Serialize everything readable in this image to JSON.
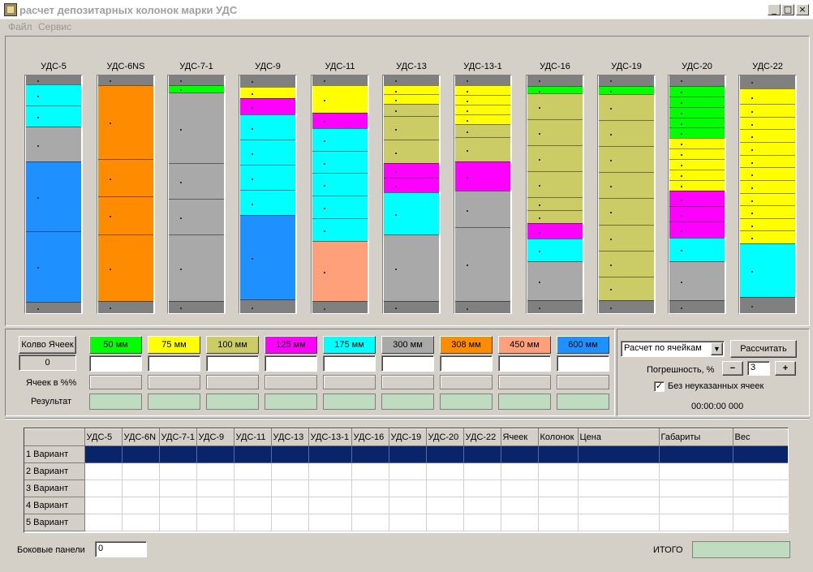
{
  "window": {
    "title": "расчет депозитарных колонок марки УДС",
    "minimize": "_",
    "maximize": "□",
    "close": "×"
  },
  "menu": {
    "file": "Файл",
    "service": "Сервис"
  },
  "columns": [
    {
      "label": "УДС-5",
      "segments": [
        {
          "color": "#808080",
          "frac": 0.04
        },
        {
          "color": "#00ffff",
          "frac": 0.09
        },
        {
          "color": "#00ffff",
          "frac": 0.09
        },
        {
          "color": "#a9a9a9",
          "frac": 0.15
        },
        {
          "color": "#1e90ff",
          "frac": 0.3
        },
        {
          "color": "#1e90ff",
          "frac": 0.3
        },
        {
          "color": "#808080",
          "frac": 0.05
        }
      ]
    },
    {
      "label": "УДС-6NS",
      "segments": [
        {
          "color": "#808080",
          "frac": 0.04
        },
        {
          "color": "#ff8c00",
          "frac": 0.31
        },
        {
          "color": "#ff8c00",
          "frac": 0.16
        },
        {
          "color": "#ff8c00",
          "frac": 0.16
        },
        {
          "color": "#ff8c00",
          "frac": 0.28
        },
        {
          "color": "#808080",
          "frac": 0.05
        }
      ]
    },
    {
      "label": "УДС-7-1",
      "segments": [
        {
          "color": "#808080",
          "frac": 0.04
        },
        {
          "color": "#00ff00",
          "frac": 0.03
        },
        {
          "color": "#a9a9a9",
          "frac": 0.3
        },
        {
          "color": "#a9a9a9",
          "frac": 0.15
        },
        {
          "color": "#a9a9a9",
          "frac": 0.15
        },
        {
          "color": "#a9a9a9",
          "frac": 0.28
        },
        {
          "color": "#808080",
          "frac": 0.05
        }
      ]
    },
    {
      "label": "УДС-9",
      "segments": [
        {
          "color": "#808080",
          "frac": 0.04
        },
        {
          "color": "#ffff00",
          "frac": 0.04
        },
        {
          "color": "#ff00ff",
          "frac": 0.06
        },
        {
          "color": "#00ffff",
          "frac": 0.09
        },
        {
          "color": "#00ffff",
          "frac": 0.09
        },
        {
          "color": "#00ffff",
          "frac": 0.09
        },
        {
          "color": "#00ffff",
          "frac": 0.09
        },
        {
          "color": "#1e90ff",
          "frac": 0.3
        },
        {
          "color": "#808080",
          "frac": 0.05
        }
      ]
    },
    {
      "label": "УДС-11",
      "segments": [
        {
          "color": "#808080",
          "frac": 0.04
        },
        {
          "color": "#ffff00",
          "frac": 0.11
        },
        {
          "color": "#ff00ff",
          "frac": 0.06
        },
        {
          "color": "#00ffff",
          "frac": 0.09
        },
        {
          "color": "#00ffff",
          "frac": 0.09
        },
        {
          "color": "#00ffff",
          "frac": 0.09
        },
        {
          "color": "#00ffff",
          "frac": 0.09
        },
        {
          "color": "#00ffff",
          "frac": 0.09
        },
        {
          "color": "#ffa07a",
          "frac": 0.24
        },
        {
          "color": "#808080",
          "frac": 0.05
        }
      ]
    },
    {
      "label": "УДС-13",
      "segments": [
        {
          "color": "#808080",
          "frac": 0.04
        },
        {
          "color": "#ffff00",
          "frac": 0.04
        },
        {
          "color": "#ffff00",
          "frac": 0.04
        },
        {
          "color": "#cccc66",
          "frac": 0.05
        },
        {
          "color": "#cccc66",
          "frac": 0.1
        },
        {
          "color": "#cccc66",
          "frac": 0.1
        },
        {
          "color": "#ff00ff",
          "frac": 0.06
        },
        {
          "color": "#ff00ff",
          "frac": 0.06
        },
        {
          "color": "#00ffff",
          "frac": 0.18
        },
        {
          "color": "#a9a9a9",
          "frac": 0.28
        },
        {
          "color": "#808080",
          "frac": 0.05
        }
      ]
    },
    {
      "label": "УДС-13-1",
      "segments": [
        {
          "color": "#808080",
          "frac": 0.04
        },
        {
          "color": "#ffff00",
          "frac": 0.04
        },
        {
          "color": "#ffff00",
          "frac": 0.04
        },
        {
          "color": "#ffff00",
          "frac": 0.04
        },
        {
          "color": "#ffff00",
          "frac": 0.04
        },
        {
          "color": "#cccc66",
          "frac": 0.05
        },
        {
          "color": "#cccc66",
          "frac": 0.1
        },
        {
          "color": "#ff00ff",
          "frac": 0.12
        },
        {
          "color": "#a9a9a9",
          "frac": 0.15
        },
        {
          "color": "#a9a9a9",
          "frac": 0.3
        },
        {
          "color": "#808080",
          "frac": 0.05
        }
      ]
    },
    {
      "label": "УДС-16",
      "segments": [
        {
          "color": "#808080",
          "frac": 0.04
        },
        {
          "color": "#00ff00",
          "frac": 0.03
        },
        {
          "color": "#cccc66",
          "frac": 0.1
        },
        {
          "color": "#cccc66",
          "frac": 0.1
        },
        {
          "color": "#cccc66",
          "frac": 0.1
        },
        {
          "color": "#cccc66",
          "frac": 0.1
        },
        {
          "color": "#cccc66",
          "frac": 0.05
        },
        {
          "color": "#cccc66",
          "frac": 0.05
        },
        {
          "color": "#ff00ff",
          "frac": 0.06
        },
        {
          "color": "#00ffff",
          "frac": 0.09
        },
        {
          "color": "#a9a9a9",
          "frac": 0.15
        },
        {
          "color": "#808080",
          "frac": 0.05
        }
      ]
    },
    {
      "label": "УДС-19",
      "segments": [
        {
          "color": "#808080",
          "frac": 0.04
        },
        {
          "color": "#00ff00",
          "frac": 0.03
        },
        {
          "color": "#cccc66",
          "frac": 0.1
        },
        {
          "color": "#cccc66",
          "frac": 0.1
        },
        {
          "color": "#cccc66",
          "frac": 0.1
        },
        {
          "color": "#cccc66",
          "frac": 0.1
        },
        {
          "color": "#cccc66",
          "frac": 0.1
        },
        {
          "color": "#cccc66",
          "frac": 0.1
        },
        {
          "color": "#cccc66",
          "frac": 0.1
        },
        {
          "color": "#cccc66",
          "frac": 0.09
        },
        {
          "color": "#808080",
          "frac": 0.05
        }
      ]
    },
    {
      "label": "УДС-20",
      "segments": [
        {
          "color": "#808080",
          "frac": 0.04
        },
        {
          "color": "#00ff00",
          "frac": 0.04
        },
        {
          "color": "#00ff00",
          "frac": 0.04
        },
        {
          "color": "#00ff00",
          "frac": 0.04
        },
        {
          "color": "#00ff00",
          "frac": 0.04
        },
        {
          "color": "#00ff00",
          "frac": 0.04
        },
        {
          "color": "#ffff00",
          "frac": 0.04
        },
        {
          "color": "#ffff00",
          "frac": 0.04
        },
        {
          "color": "#ffff00",
          "frac": 0.04
        },
        {
          "color": "#ffff00",
          "frac": 0.04
        },
        {
          "color": "#ffff00",
          "frac": 0.04
        },
        {
          "color": "#ff00ff",
          "frac": 0.06
        },
        {
          "color": "#ff00ff",
          "frac": 0.06
        },
        {
          "color": "#ff00ff",
          "frac": 0.06
        },
        {
          "color": "#00ffff",
          "frac": 0.09
        },
        {
          "color": "#a9a9a9",
          "frac": 0.15
        },
        {
          "color": "#808080",
          "frac": 0.05
        }
      ]
    },
    {
      "label": "УДС-22",
      "segments": [
        {
          "color": "#808080",
          "frac": 0.04
        },
        {
          "color": "#ffff00",
          "frac": 0.05
        },
        {
          "color": "#ffff00",
          "frac": 0.04
        },
        {
          "color": "#ffff00",
          "frac": 0.04
        },
        {
          "color": "#ffff00",
          "frac": 0.04
        },
        {
          "color": "#ffff00",
          "frac": 0.04
        },
        {
          "color": "#ffff00",
          "frac": 0.04
        },
        {
          "color": "#ffff00",
          "frac": 0.04
        },
        {
          "color": "#ffff00",
          "frac": 0.04
        },
        {
          "color": "#ffff00",
          "frac": 0.04
        },
        {
          "color": "#ffff00",
          "frac": 0.04
        },
        {
          "color": "#ffff00",
          "frac": 0.04
        },
        {
          "color": "#ffff00",
          "frac": 0.04
        },
        {
          "color": "#00ffff",
          "frac": 0.17
        },
        {
          "color": "#808080",
          "frac": 0.05
        }
      ]
    }
  ],
  "controls": {
    "cells_count_label": "Колво Ячеек",
    "cells_count_value": "0",
    "percent_label": "Ячеек в %%",
    "result_label": "Результат",
    "sizes": [
      {
        "label": "50 мм",
        "color": "#00ff00",
        "value": ""
      },
      {
        "label": "75 мм",
        "color": "#ffff00",
        "value": ""
      },
      {
        "label": "100 мм",
        "color": "#cccc66",
        "value": ""
      },
      {
        "label": "125 мм",
        "color": "#ff00ff",
        "value": ""
      },
      {
        "label": "175 мм",
        "color": "#00ffff",
        "value": ""
      },
      {
        "label": "300 мм",
        "color": "#a9a9a9",
        "value": ""
      },
      {
        "label": "308 мм",
        "color": "#ff8c00",
        "value": ""
      },
      {
        "label": "450 мм",
        "color": "#ffa07a",
        "value": ""
      },
      {
        "label": "600 мм",
        "color": "#1e90ff",
        "value": ""
      }
    ]
  },
  "calc": {
    "mode_select": "Расчет по ячейкам",
    "calculate_button": "Рассчитать",
    "error_label": "Погрешность, %",
    "minus": "−",
    "plus": "+",
    "error_value": "3",
    "checkbox_label": "Без неуказанных ячеек",
    "checkbox_checked": true,
    "timer": "00:00:00 000"
  },
  "grid": {
    "columns": [
      "УДС-5",
      "УДС-6N",
      "УДС-7-1",
      "УДС-9",
      "УДС-11",
      "УДС-13",
      "УДС-13-1",
      "УДС-16",
      "УДС-19",
      "УДС-20",
      "УДС-22",
      "Ячеек",
      "Колонок",
      "Цена",
      "Габариты",
      "Вес"
    ],
    "rows": [
      "1 Вариант",
      "2 Вариант",
      "3 Вариант",
      "4 Вариант",
      "5 Вариант"
    ],
    "selected_row": 0
  },
  "footer": {
    "side_panels_label": "Боковые панели",
    "side_panels_value": "0",
    "total_label": "ИТОГО",
    "total_value": ""
  }
}
